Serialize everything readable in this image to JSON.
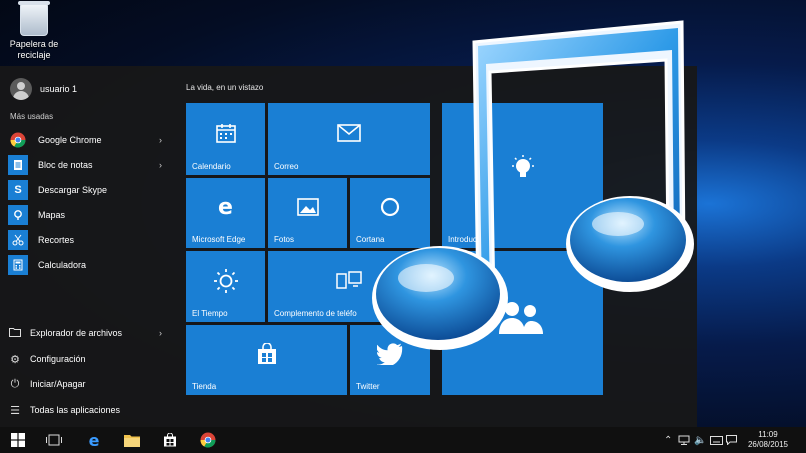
{
  "desktop": {
    "recycle_bin_label": "Papelera de reciclaje"
  },
  "start_menu": {
    "user_name": "usuario 1",
    "most_used_heading": "Más usadas",
    "most_used": [
      {
        "label": "Google Chrome",
        "icon": "chrome-icon",
        "has_submenu": true
      },
      {
        "label": "Bloc de notas",
        "icon": "notepad-icon",
        "has_submenu": true
      },
      {
        "label": "Descargar Skype",
        "icon": "skype-icon",
        "has_submenu": false
      },
      {
        "label": "Mapas",
        "icon": "maps-icon",
        "has_submenu": false
      },
      {
        "label": "Recortes",
        "icon": "snipping-tool-icon",
        "has_submenu": false
      },
      {
        "label": "Calculadora",
        "icon": "calculator-icon",
        "has_submenu": false
      }
    ],
    "system_items": [
      {
        "label": "Explorador de archivos",
        "icon": "folder-icon",
        "has_submenu": true
      },
      {
        "label": "Configuración",
        "icon": "gear-icon",
        "has_submenu": false
      },
      {
        "label": "Iniciar/Apagar",
        "icon": "power-icon",
        "has_submenu": false
      },
      {
        "label": "Todas las aplicaciones",
        "icon": "list-icon",
        "has_submenu": false
      }
    ],
    "glance_heading": "La vida, en un vistazo",
    "tiles": {
      "calendario": "Calendario",
      "correo": "Correo",
      "edge": "Microsoft Edge",
      "fotos": "Fotos",
      "cortana": "Cortana",
      "tiempo": "El Tiempo",
      "complemento": "Complemento de teléfo",
      "tienda": "Tienda",
      "twitter": "Twitter",
      "intro": "Introducción"
    }
  },
  "taskbar": {
    "time": "11:09",
    "date": "26/08/2015"
  },
  "colors": {
    "tile_blue": "#1a7fd4",
    "start_bg": "#181818",
    "taskbar_bg": "#101010"
  }
}
